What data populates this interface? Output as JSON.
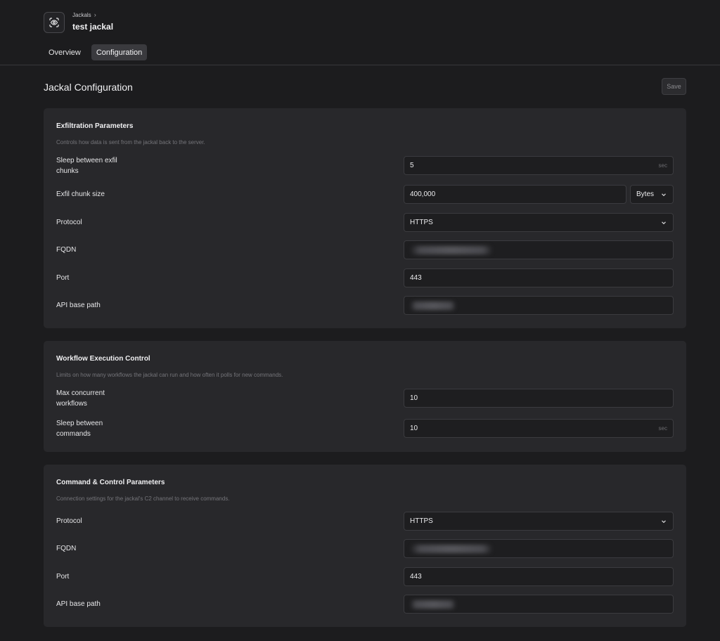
{
  "header": {
    "breadcrumb": "Jackals",
    "title": "test jackal",
    "tabs": [
      {
        "label": "Overview",
        "active": false
      },
      {
        "label": "Configuration",
        "active": true
      }
    ]
  },
  "config": {
    "title": "Jackal Configuration",
    "save_label": "Save"
  },
  "exfil": {
    "title": "Exfiltration Parameters",
    "description": "Controls how data is sent from the jackal back to the server.",
    "sleep_label": "Sleep between exfil chunks",
    "sleep_value": "5",
    "sleep_unit": "sec",
    "chunk_label": "Exfil chunk size",
    "chunk_value": "400,000",
    "chunk_unit": "Bytes",
    "protocol_label": "Protocol",
    "protocol_value": "HTTPS",
    "fqdn_label": "FQDN",
    "port_label": "Port",
    "port_value": "443",
    "api_label": "API base path"
  },
  "workflow": {
    "title": "Workflow Execution Control",
    "description": "Limits on how many workflows the jackal can run and how often it polls for new commands.",
    "max_label": "Max concurrent workflows",
    "max_value": "10",
    "sleep_label": "Sleep between commands",
    "sleep_value": "10",
    "sleep_unit": "sec"
  },
  "c2": {
    "title": "Command & Control Parameters",
    "description": "Connection settings for the jackal's C2 channel to receive commands.",
    "protocol_label": "Protocol",
    "protocol_value": "HTTPS",
    "fqdn_label": "FQDN",
    "port_label": "Port",
    "port_value": "443",
    "api_label": "API base path"
  },
  "colors": {
    "background": "#1c1c1e",
    "card": "#28282b",
    "input": "#1e1e20",
    "active_tab": "#3a3a3e"
  }
}
